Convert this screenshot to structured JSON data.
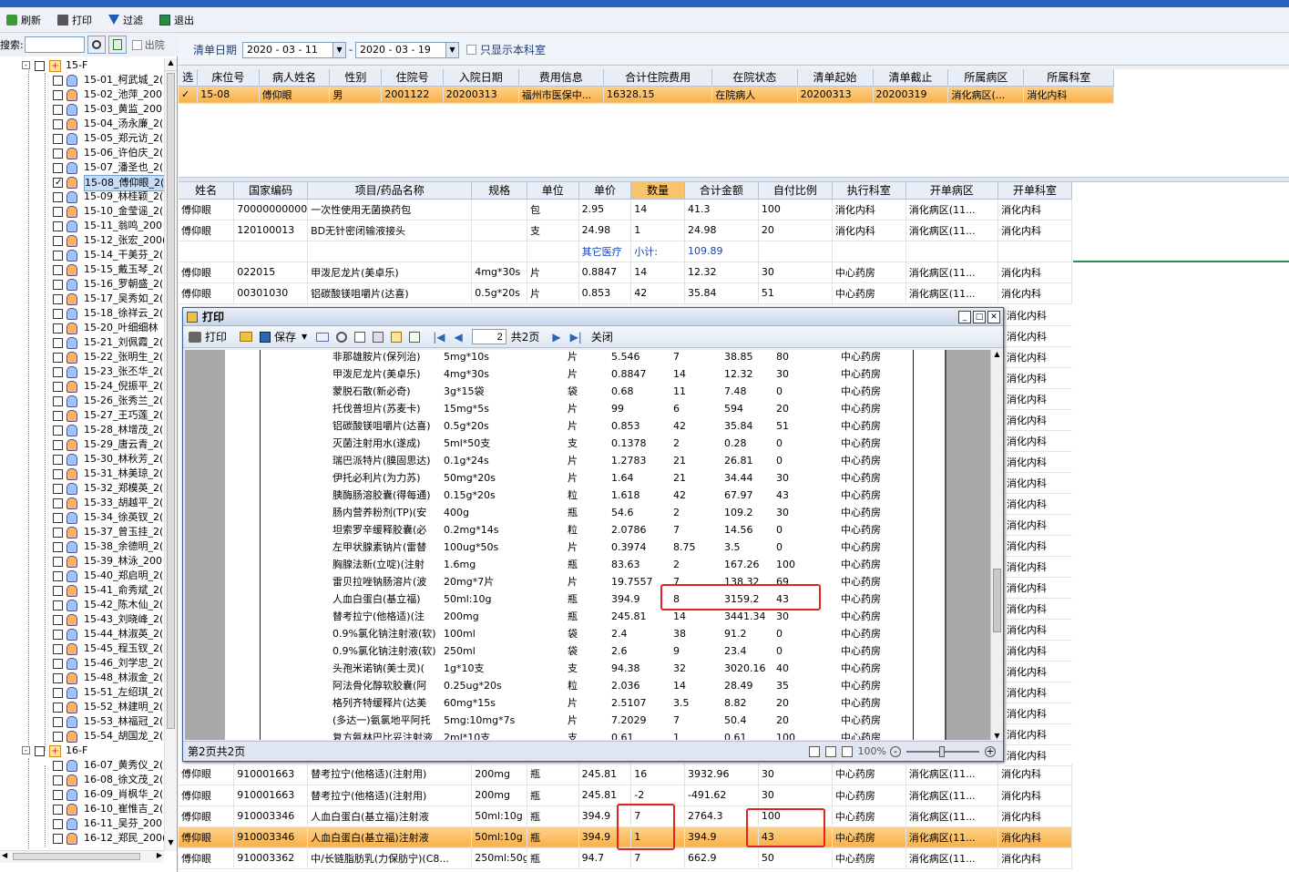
{
  "toolbar": {
    "refresh": "刷新",
    "print": "打印",
    "filter": "过滤",
    "exit": "退出"
  },
  "search": {
    "label": "搜索:",
    "checkbox": "出院"
  },
  "tree": {
    "ward_15": "15-F",
    "ward_16": "16-F",
    "ward_15_beds": [
      "15-01_柯武城_2(",
      "15-02_池萍_200",
      "15-03_黄监_200",
      "15-04_汤永廉_2(",
      "15-05_郑元访_2(",
      "15-06_许伯庆_2(",
      "15-07_潘圣也_2(",
      "15-08_傅仰眼_2(",
      "15-09_林桂颖_2(",
      "15-10_金莹谣_2(",
      "15-11_翁鸣_200",
      "15-12_张宏_200(",
      "15-14_干美芬_2(",
      "15-15_戴玉琴_2(",
      "15-16_罗朝盛_2(",
      "15-17_吴秀如_2(",
      "15-18_徐祥云_2(",
      "15-20_叶细细林",
      "15-21_刘佩霞_2(",
      "15-22_张明生_2(",
      "15-23_张丕华_2(",
      "15-24_倪振平_2(",
      "15-26_张秀兰_2(",
      "15-27_王巧莲_2(",
      "15-28_林增茂_2(",
      "15-29_唐云青_2(",
      "15-30_林秋芳_2(",
      "15-31_林美琼_2(",
      "15-32_郑模英_2(",
      "15-33_胡越平_2(",
      "15-34_徐英钗_2(",
      "15-37_曾玉挂_2(",
      "15-38_余德明_2(",
      "15-39_林泳_200",
      "15-40_郑启明_2(",
      "15-41_俞秀斌_2(",
      "15-42_陈木仙_2(",
      "15-43_刘晓峰_2(",
      "15-44_林淑英_2(",
      "15-45_程玉钗_2(",
      "15-46_刘学忠_2(",
      "15-48_林淑金_2(",
      "15-51_左绍琪_2(",
      "15-52_林建明_2(",
      "15-53_林福冠_2(",
      "15-54_胡国龙_2("
    ],
    "ward_16_beds": [
      "16-07_黄秀仪_2(",
      "16-08_徐文茂_2(",
      "16-09_肖枫华_2(",
      "16-10_崔惟吉_2(",
      "16-11_吴芬_200",
      "16-12_郑民_200("
    ]
  },
  "filter": {
    "date_label": "清单日期",
    "date_from": "2020 - 03 - 11",
    "date_sep": "-",
    "date_to": "2020 - 03 - 19",
    "only_dept": "只显示本科室"
  },
  "grid1": {
    "headers": [
      "选",
      "床位号",
      "病人姓名",
      "性别",
      "住院号",
      "入院日期",
      "费用信息",
      "合计住院费用",
      "在院状态",
      "清单起始",
      "清单截止",
      "所属病区",
      "所属科室"
    ],
    "rows": [
      [
        "✓",
        "15-08",
        "傅仰眼",
        "男",
        "2001122",
        "20200313",
        "福州市医保中...",
        "16328.15",
        "在院病人",
        "20200313",
        "20200319",
        "消化病区(...",
        "消化内科"
      ]
    ]
  },
  "grid2": {
    "headers": [
      "姓名",
      "国家编码",
      "项目/药品名称",
      "规格",
      "单位",
      "单价",
      "数量",
      "合计金额",
      "自付比例",
      "执行科室",
      "开单病区",
      "开单科室"
    ],
    "rows_top": [
      [
        "傅仰眼",
        "700000000004",
        "一次性使用无菌换药包",
        "",
        "包",
        "2.95",
        "14",
        "41.3",
        "100",
        "消化内科",
        "消化病区(11...",
        "消化内科"
      ],
      [
        "傅仰眼",
        "120100013",
        "BD无针密闭输液接头",
        "",
        "支",
        "24.98",
        "1",
        "24.98",
        "20",
        "消化内科",
        "消化病区(11...",
        "消化内科"
      ],
      [
        "",
        "",
        "",
        "",
        "",
        "其它医疗",
        "小计:",
        "109.89",
        "",
        "",
        "",
        ""
      ],
      [
        "傅仰眼",
        "022015",
        "甲泼尼龙片(美卓乐)",
        "4mg*30s",
        "片",
        "0.8847",
        "14",
        "12.32",
        "30",
        "中心药房",
        "消化病区(11...",
        "消化内科"
      ],
      [
        "傅仰眼",
        "00301030",
        "铝碳酸镁咀嚼片(达喜)",
        "0.5g*20s",
        "片",
        "0.853",
        "42",
        "35.84",
        "51",
        "中心药房",
        "消化病区(11...",
        "消化内科"
      ]
    ],
    "right_col": [
      "消化内科",
      "消化内科",
      "消化内科",
      "消化内科",
      "消化内科",
      "消化内科",
      "消化内科",
      "消化内科",
      "消化内科",
      "消化内科",
      "消化内科",
      "消化内科",
      "消化内科",
      "消化内科",
      "消化内科",
      "消化内科",
      "消化内科",
      "消化内科",
      "消化内科",
      "消化内科",
      "消化内科",
      "消化内科"
    ],
    "rows_bottom": [
      [
        "傅仰眼",
        "910001663",
        "替考拉宁(他格适)(注射用)",
        "200mg",
        "瓶",
        "245.81",
        "16",
        "3932.96",
        "30",
        "中心药房",
        "消化病区(11...",
        "消化内科"
      ],
      [
        "傅仰眼",
        "910001663",
        "替考拉宁(他格适)(注射用)",
        "200mg",
        "瓶",
        "245.81",
        "-2",
        "-491.62",
        "30",
        "中心药房",
        "消化病区(11...",
        "消化内科"
      ],
      [
        "傅仰眼",
        "910003346",
        "人血白蛋白(基立福)注射液",
        "50ml:10g",
        "瓶",
        "394.9",
        "7",
        "2764.3",
        "100",
        "中心药房",
        "消化病区(11...",
        "消化内科"
      ],
      [
        "傅仰眼",
        "910003346",
        "人血白蛋白(基立福)注射液",
        "50ml:10g",
        "瓶",
        "394.9",
        "1",
        "394.9",
        "43",
        "中心药房",
        "消化病区(11...",
        "消化内科"
      ],
      [
        "傅仰眼",
        "910003362",
        "中/长链脂肪乳(力保肪宁)(C8...",
        "250ml:50g",
        "瓶",
        "94.7",
        "7",
        "662.9",
        "50",
        "中心药房",
        "消化病区(11...",
        "消化内科"
      ]
    ]
  },
  "dialog": {
    "title": "打印",
    "print": "打印",
    "save": "保存",
    "page_value": "2",
    "page_total": "共2页",
    "close": "关闭",
    "status": "第2页共2页",
    "zoom": "100%",
    "rows": [
      [
        "非那雄胺片(保列治)",
        "5mg*10s",
        "片",
        "5.546",
        "7",
        "38.85",
        "80",
        "中心药房"
      ],
      [
        "甲泼尼龙片(美卓乐)",
        "4mg*30s",
        "片",
        "0.8847",
        "14",
        "12.32",
        "30",
        "中心药房"
      ],
      [
        "蒙脱石散(新必奇)",
        "3g*15袋",
        "袋",
        "0.68",
        "11",
        "7.48",
        "0",
        "中心药房"
      ],
      [
        "托伐普坦片(苏麦卡)",
        "15mg*5s",
        "片",
        "99",
        "6",
        "594",
        "20",
        "中心药房"
      ],
      [
        "铝碳酸镁咀嚼片(达喜)",
        "0.5g*20s",
        "片",
        "0.853",
        "42",
        "35.84",
        "51",
        "中心药房"
      ],
      [
        "灭菌注射用水(遂成)",
        "5ml*50支",
        "支",
        "0.1378",
        "2",
        "0.28",
        "0",
        "中心药房"
      ],
      [
        "瑞巴派特片(膜固思达)",
        "0.1g*24s",
        "片",
        "1.2783",
        "21",
        "26.81",
        "0",
        "中心药房"
      ],
      [
        "伊托必利片(为力苏)",
        "50mg*20s",
        "片",
        "1.64",
        "21",
        "34.44",
        "30",
        "中心药房"
      ],
      [
        "胰酶肠溶胶囊(得每通)",
        "0.15g*20s",
        "粒",
        "1.618",
        "42",
        "67.97",
        "43",
        "中心药房"
      ],
      [
        "肠内营养粉剂(TP)(安",
        "400g",
        "瓶",
        "54.6",
        "2",
        "109.2",
        "30",
        "中心药房"
      ],
      [
        "坦索罗辛缓释胶囊(必",
        "0.2mg*14s",
        "粒",
        "2.0786",
        "7",
        "14.56",
        "0",
        "中心药房"
      ],
      [
        "左甲状腺素钠片(雷替",
        "100ug*50s",
        "片",
        "0.3974",
        "8.75",
        "3.5",
        "0",
        "中心药房"
      ],
      [
        "胸腺法新(立啶)(注射",
        "1.6mg",
        "瓶",
        "83.63",
        "2",
        "167.26",
        "100",
        "中心药房"
      ],
      [
        "雷贝拉唑钠肠溶片(波",
        "20mg*7片",
        "片",
        "19.7557",
        "7",
        "138.32",
        "69",
        "中心药房"
      ],
      [
        "人血白蛋白(基立福)",
        "50ml:10g",
        "瓶",
        "394.9",
        "8",
        "3159.2",
        "43",
        "中心药房"
      ],
      [
        "替考拉宁(他格适)(注",
        "200mg",
        "瓶",
        "245.81",
        "14",
        "3441.34",
        "30",
        "中心药房"
      ],
      [
        "0.9%氯化钠注射液(软)",
        "100ml",
        "袋",
        "2.4",
        "38",
        "91.2",
        "0",
        "中心药房"
      ],
      [
        "0.9%氯化钠注射液(软)",
        "250ml",
        "袋",
        "2.6",
        "9",
        "23.4",
        "0",
        "中心药房"
      ],
      [
        "头孢米诺钠(美士灵)(",
        "1g*10支",
        "支",
        "94.38",
        "32",
        "3020.16",
        "40",
        "中心药房"
      ],
      [
        "阿法骨化醇软胶囊(阿",
        "0.25ug*20s",
        "粒",
        "2.036",
        "14",
        "28.49",
        "35",
        "中心药房"
      ],
      [
        "格列齐特缓释片(达美",
        "60mg*15s",
        "片",
        "2.5107",
        "3.5",
        "8.82",
        "20",
        "中心药房"
      ],
      [
        "(多达一)氨氯地平阿托",
        "5mg:10mg*7s",
        "片",
        "7.2029",
        "7",
        "50.4",
        "20",
        "中心药房"
      ],
      [
        "复方氨林巴比妥注射液",
        "2ml*10支",
        "支",
        "0.61",
        "1",
        "0.61",
        "100",
        "中心药房"
      ]
    ]
  },
  "colors": {
    "selected_row": "#f9b04a",
    "highlight_box": "#e32222",
    "title_blue": "#2a62c4"
  }
}
